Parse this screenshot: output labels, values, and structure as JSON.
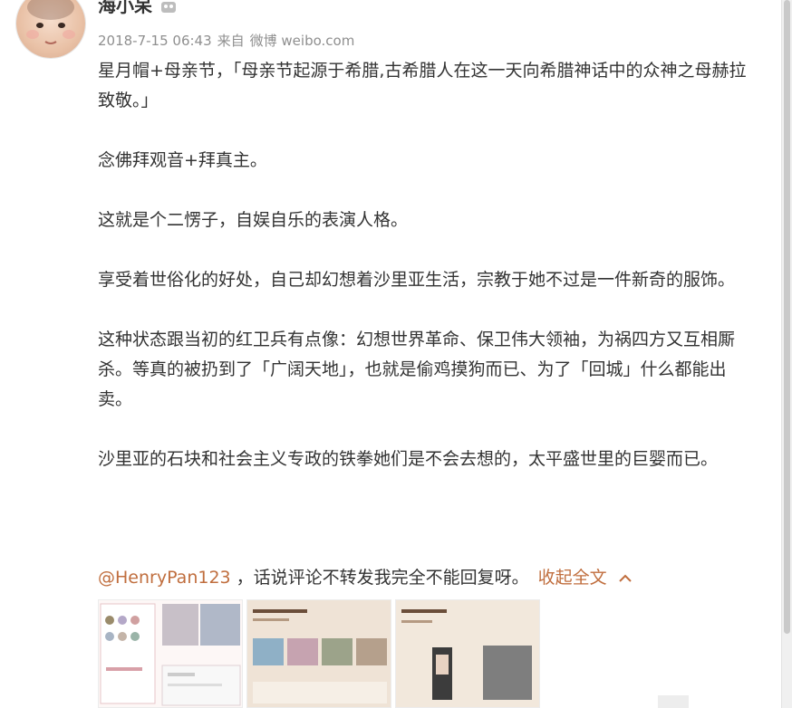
{
  "post": {
    "username": "海小呆",
    "meta": {
      "time": "2018-7-15 06:43",
      "from_label": "来自",
      "source": "微博 weibo.com"
    },
    "paragraphs": [
      "星月帽+母亲节，「母亲节起源于希腊,古希腊人在这一天向希腊神话中的众神之母赫拉致敬。」",
      "念佛拜观音+拜真主。",
      "这就是个二愣子，自娱自乐的表演人格。",
      "享受着世俗化的好处，自己却幻想着沙里亚生活，宗教于她不过是一件新奇的服饰。",
      "这种状态跟当初的红卫兵有点像：幻想世界革命、保卫伟大领袖，为祸四方又互相厮杀。等真的被扔到了「广阔天地」，也就是偷鸡摸狗而已、为了「回城」什么都能出卖。",
      "沙里亚的石块和社会主义专政的铁拳她们是不会去想的，太平盛世里的巨婴而已。"
    ],
    "mention": "@HenryPan123",
    "mention_text": "，话说评论不转发我完全不能回复呀。",
    "collapse_label": "收起全文",
    "collapse_icon": "chevron-up-icon"
  },
  "colors": {
    "link": "#c06e3e",
    "text": "#333333",
    "meta": "#8f8f8f"
  }
}
